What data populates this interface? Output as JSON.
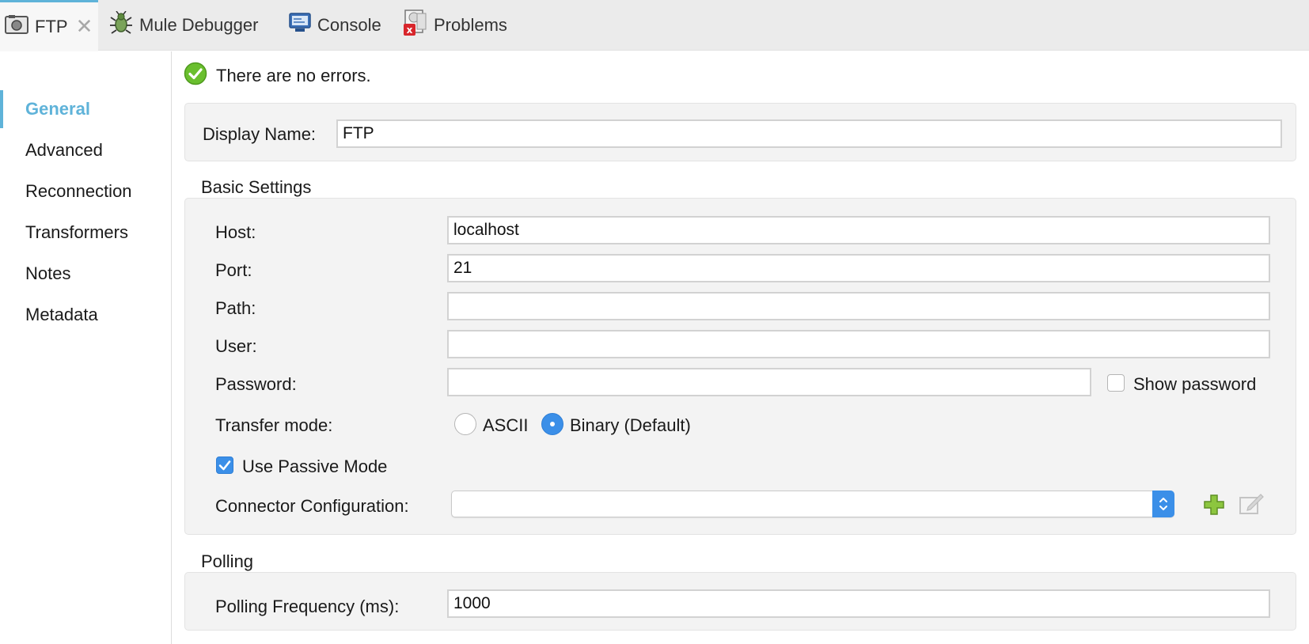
{
  "tabs": [
    {
      "label": "FTP",
      "icon": "ftp-endpoint-icon",
      "active": true,
      "closable": true
    },
    {
      "label": "Mule Debugger",
      "icon": "bug-icon"
    },
    {
      "label": "Console",
      "icon": "console-monitor-icon"
    },
    {
      "label": "Problems",
      "icon": "problems-icon"
    }
  ],
  "nav": {
    "items": [
      {
        "label": "General",
        "active": true
      },
      {
        "label": "Advanced"
      },
      {
        "label": "Reconnection"
      },
      {
        "label": "Transformers"
      },
      {
        "label": "Notes"
      },
      {
        "label": "Metadata"
      }
    ]
  },
  "status": {
    "text": "There are no errors.",
    "icon": "check-circle-icon"
  },
  "display_name": {
    "label": "Display Name:",
    "value": "FTP"
  },
  "basic_settings": {
    "title": "Basic Settings",
    "host": {
      "label": "Host:",
      "value": "localhost"
    },
    "port": {
      "label": "Port:",
      "value": "21"
    },
    "path": {
      "label": "Path:",
      "value": ""
    },
    "user": {
      "label": "User:",
      "value": ""
    },
    "password": {
      "label": "Password:",
      "value": ""
    },
    "show_password": {
      "label": "Show password",
      "checked": false
    },
    "transfer_mode": {
      "label": "Transfer mode:",
      "options": [
        {
          "label": "ASCII",
          "selected": false
        },
        {
          "label": "Binary (Default)",
          "selected": true
        }
      ]
    },
    "passive_mode": {
      "label": "Use Passive Mode",
      "checked": true
    },
    "connector_config": {
      "label": "Connector Configuration:",
      "value": ""
    }
  },
  "polling": {
    "title": "Polling",
    "frequency": {
      "label": "Polling Frequency (ms):",
      "value": "1000"
    }
  },
  "colors": {
    "accent": "#5fb3d9",
    "control_blue": "#3b8fe8",
    "status_green": "#6abf2e",
    "add_green": "#7ab428"
  }
}
